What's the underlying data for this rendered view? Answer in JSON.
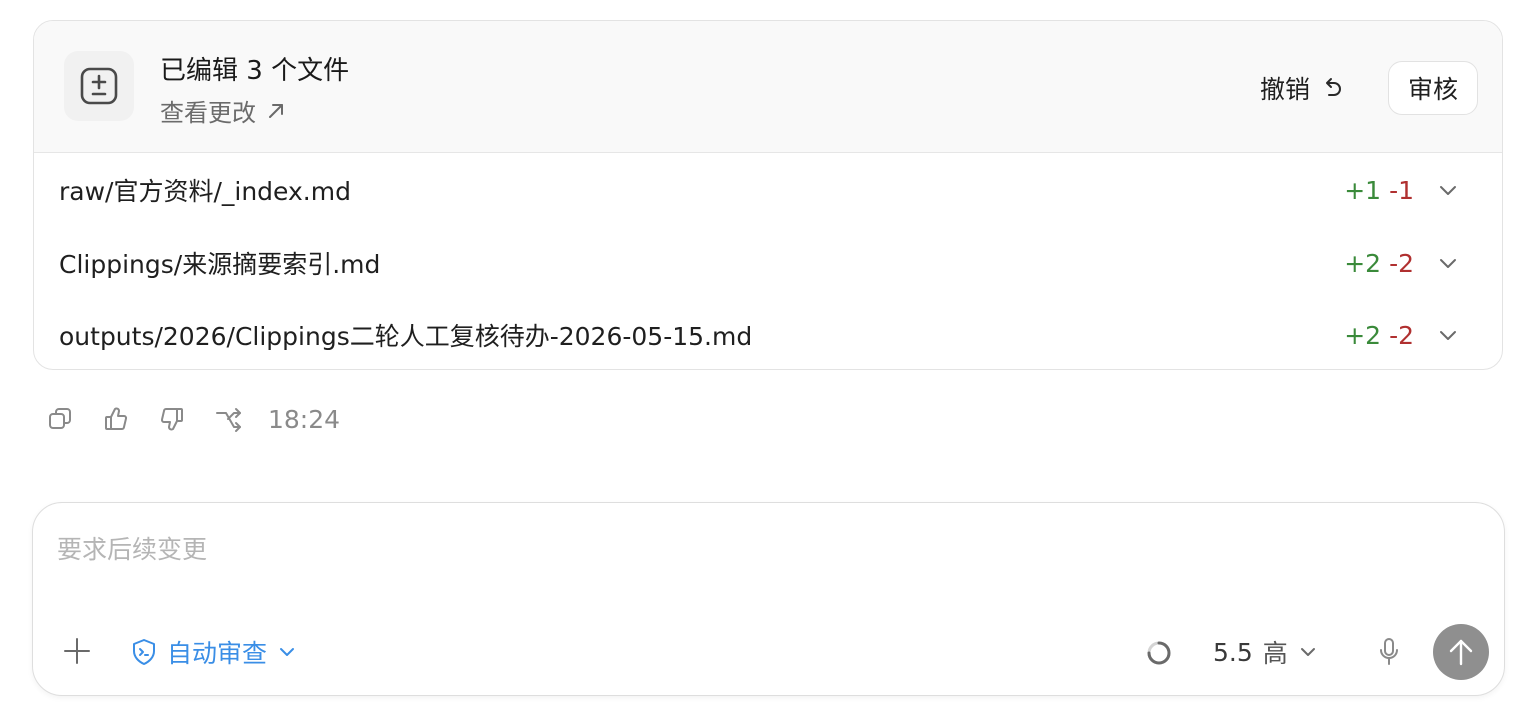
{
  "changes": {
    "title": "已编辑 3 个文件",
    "view_changes": "查看更改",
    "undo_label": "撤销",
    "review_label": "审核",
    "files": [
      {
        "path": "raw/官方资料/_index.md",
        "added": "+1",
        "removed": "-1"
      },
      {
        "path": "Clippings/来源摘要索引.md",
        "added": "+2",
        "removed": "-2"
      },
      {
        "path": "outputs/2026/Clippings二轮人工复核待办-2026-05-15.md",
        "added": "+2",
        "removed": "-2"
      }
    ]
  },
  "actions": {
    "timestamp": "18:24",
    "icons": [
      "copy-icon",
      "thumbs-up-icon",
      "thumbs-down-icon",
      "fork-icon"
    ]
  },
  "composer": {
    "placeholder": "要求后续变更",
    "auto_review_label": "自动审查",
    "model_version": "5.5",
    "model_level": "高"
  },
  "colors": {
    "added": "#3a8a3a",
    "removed": "#b03030",
    "accent": "#3a8ee6",
    "send_button": "#8f8f8f"
  }
}
